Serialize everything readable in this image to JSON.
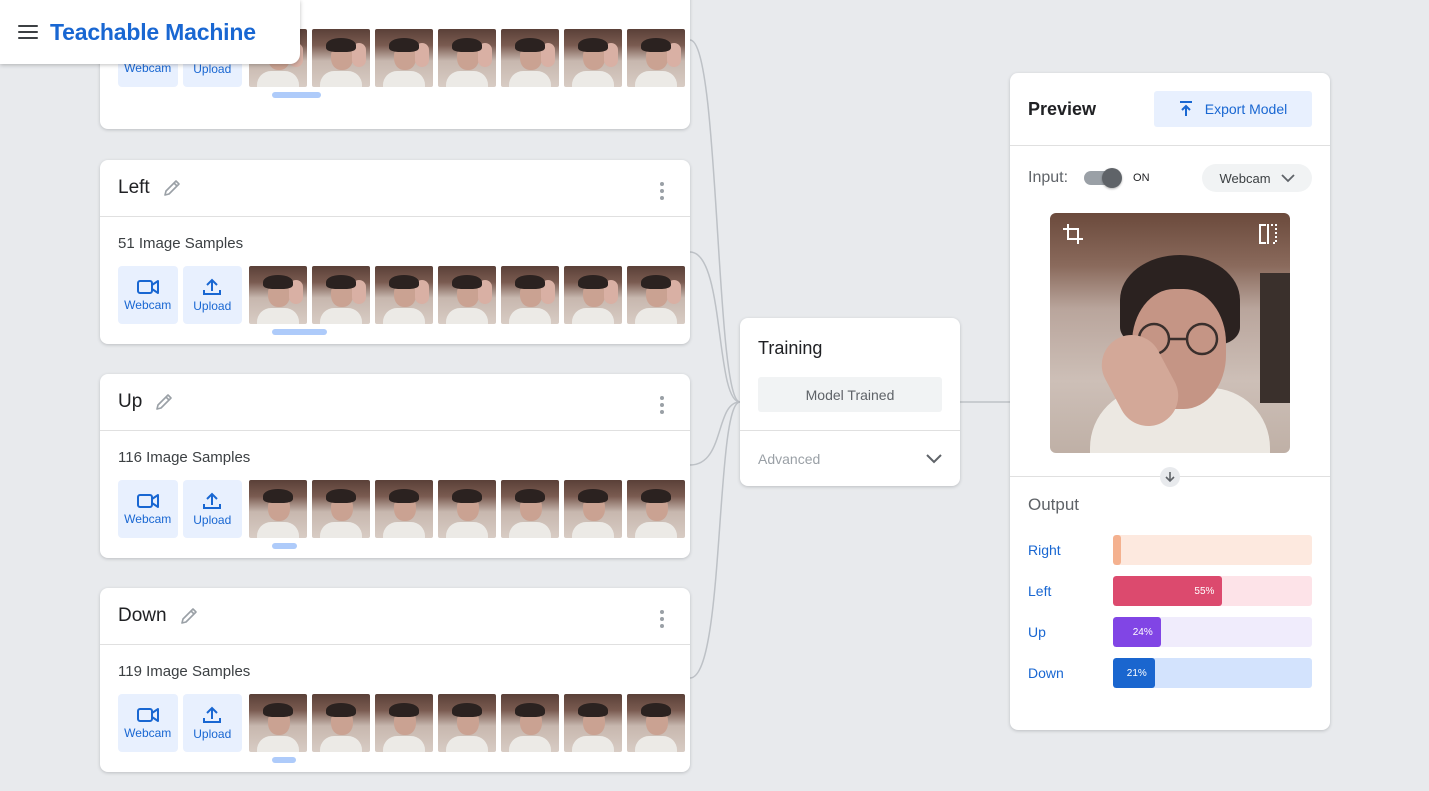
{
  "app": {
    "title": "Teachable Machine"
  },
  "classes": [
    {
      "name": "",
      "samples": "",
      "webcam_label": "Webcam",
      "upload_label": "Upload"
    },
    {
      "name": "Left",
      "samples": "51 Image Samples",
      "webcam_label": "Webcam",
      "upload_label": "Upload"
    },
    {
      "name": "Up",
      "samples": "116 Image Samples",
      "webcam_label": "Webcam",
      "upload_label": "Upload"
    },
    {
      "name": "Down",
      "samples": "119 Image Samples",
      "webcam_label": "Webcam",
      "upload_label": "Upload"
    }
  ],
  "training": {
    "title": "Training",
    "button_label": "Model Trained",
    "advanced_label": "Advanced"
  },
  "preview": {
    "title": "Preview",
    "export_label": "Export Model",
    "input_label": "Input:",
    "toggle_state": "ON",
    "source": "Webcam",
    "output_title": "Output",
    "outputs": [
      {
        "label": "Right",
        "percent": 0,
        "percent_text": "",
        "color": "#f4b18f",
        "track": "#fde9df"
      },
      {
        "label": "Left",
        "percent": 55,
        "percent_text": "55%",
        "color": "#dc4a6e",
        "track": "#fde3e8"
      },
      {
        "label": "Up",
        "percent": 24,
        "percent_text": "24%",
        "color": "#8145e5",
        "track": "#f0ecfc"
      },
      {
        "label": "Down",
        "percent": 21,
        "percent_text": "21%",
        "color": "#1a66cf",
        "track": "#d3e3fd"
      }
    ]
  }
}
